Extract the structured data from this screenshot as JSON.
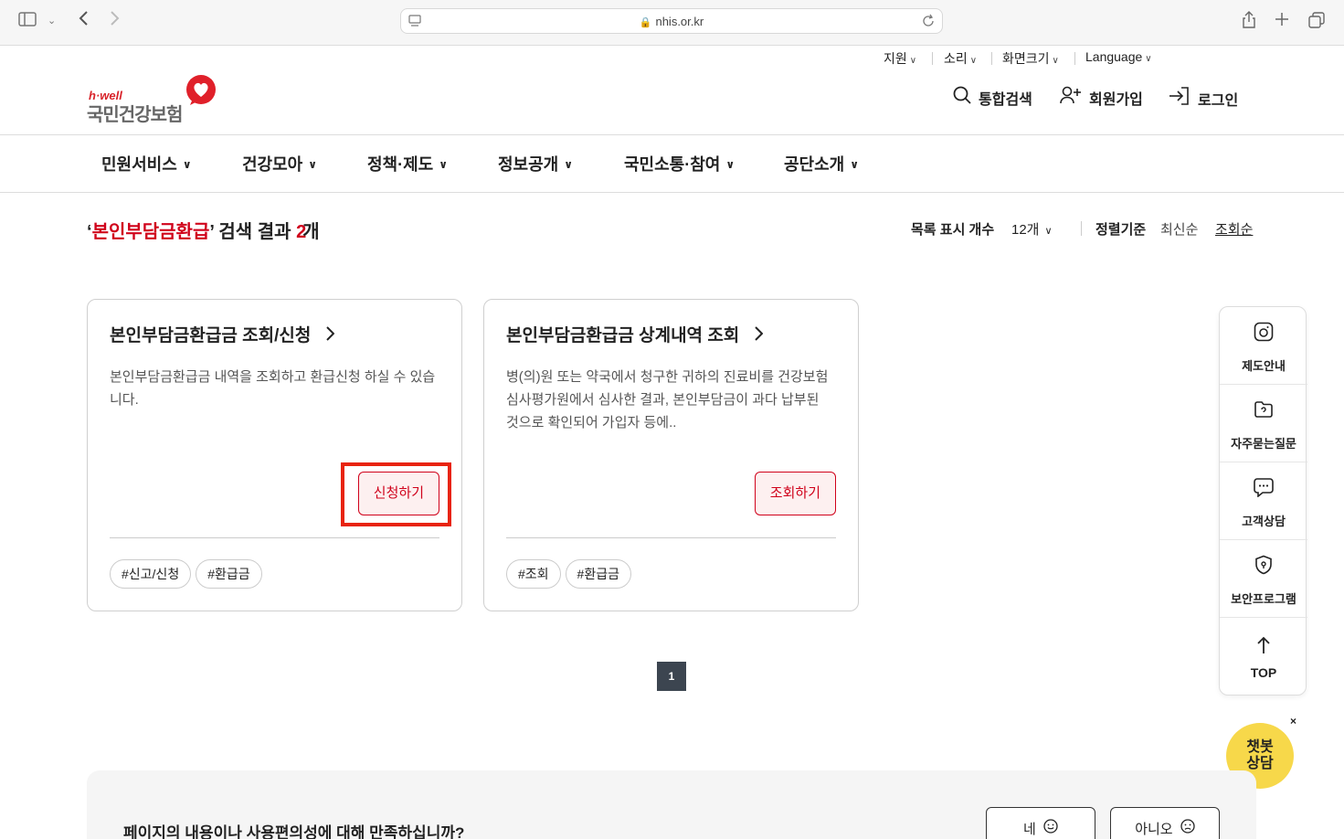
{
  "browser": {
    "url": "nhis.or.kr"
  },
  "utility_menu": {
    "support": "지원",
    "sound": "소리",
    "screen_size": "화면크기",
    "language": "Language"
  },
  "logo": {
    "tagline": "h·well",
    "name": "국민건강보험"
  },
  "header_actions": {
    "search": "통합검색",
    "signup": "회원가입",
    "login": "로그인"
  },
  "gnb": [
    {
      "label": "민원서비스"
    },
    {
      "label": "건강모아"
    },
    {
      "label": "정책·제도"
    },
    {
      "label": "정보공개"
    },
    {
      "label": "국민소통·참여"
    },
    {
      "label": "공단소개"
    }
  ],
  "results": {
    "open_quote": "‘",
    "keyword": "본인부담금환급",
    "close_quote": "’",
    "label": "검색 결과",
    "count": "2",
    "unit": "개",
    "list_count_label": "목록 표시 개수",
    "list_count_value": "12개",
    "sort_label": "정렬기준",
    "sort_latest": "최신순",
    "sort_views": "조회순"
  },
  "cards": [
    {
      "title": "본인부담금환급금 조회/신청",
      "desc": "본인부담금환급금 내역을 조회하고 환급신청 하실 수 있습니다.",
      "button": "신청하기",
      "tags": [
        "#신고/신청",
        "#환급금"
      ]
    },
    {
      "title": "본인부담금환급금 상계내역 조회",
      "desc": "병(의)원 또는 약국에서 청구한 귀하의 진료비를 건강보험심사평가원에서 심사한 결과, 본인부담금이 과다 납부된 것으로 확인되어 가입자 등에..",
      "button": "조회하기",
      "tags": [
        "#조회",
        "#환급금"
      ]
    }
  ],
  "pagination": {
    "current": "1"
  },
  "quick_menu": [
    {
      "label": "제도안내",
      "icon": "guide-icon"
    },
    {
      "label": "자주묻는질문",
      "icon": "folder-question-icon"
    },
    {
      "label": "고객상담",
      "icon": "chat-icon"
    },
    {
      "label": "보안프로그램",
      "icon": "shield-icon"
    }
  ],
  "quick_top": "TOP",
  "chatbot": {
    "line1": "챗봇",
    "line2": "상담",
    "close": "×"
  },
  "survey": {
    "question": "페이지의 내용이나 사용편의성에 대해 만족하십니까?",
    "yes": "네",
    "no": "아니오"
  },
  "colors": {
    "accent": "#d0021b",
    "highlight": "#e8230e",
    "chatbot": "#f7d84a"
  }
}
